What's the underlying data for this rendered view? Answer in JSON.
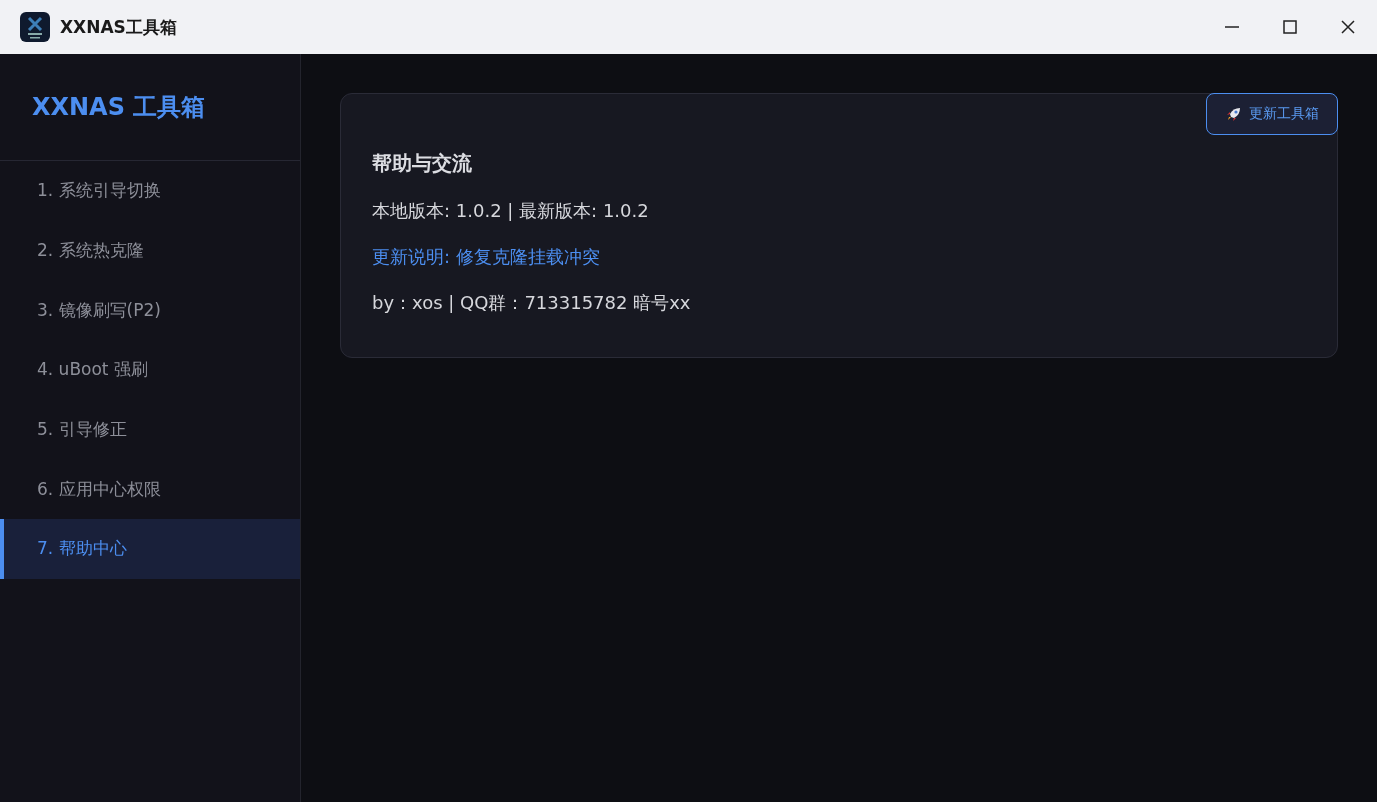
{
  "window": {
    "title": "XXNAS工具箱"
  },
  "sidebar": {
    "brand": "XXNAS 工具箱",
    "items": [
      {
        "label": "1. 系统引导切换",
        "selected": false
      },
      {
        "label": "2. 系统热克隆",
        "selected": false
      },
      {
        "label": "3. 镜像刷写(P2)",
        "selected": false
      },
      {
        "label": "4. uBoot 强刷",
        "selected": false
      },
      {
        "label": "5. 引导修正",
        "selected": false
      },
      {
        "label": "6. 应用中心权限",
        "selected": false
      },
      {
        "label": "7. 帮助中心",
        "selected": true
      }
    ]
  },
  "card": {
    "update_button": "更新工具箱",
    "title": "帮助与交流",
    "lines": [
      {
        "kind": "text",
        "text": "本地版本: 1.0.2 | 最新版本: 1.0.2"
      },
      {
        "kind": "link",
        "text": "更新说明: 修复克隆挂载冲突"
      },
      {
        "kind": "text",
        "text": "by：xos | QQ群：713315782 暗号xx"
      }
    ]
  }
}
